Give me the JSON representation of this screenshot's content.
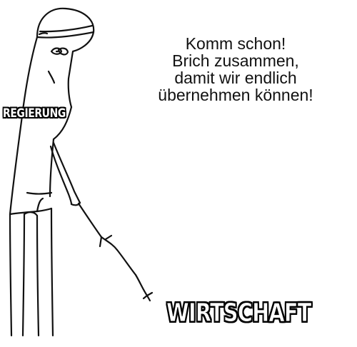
{
  "speech": {
    "lines": [
      "Komm schon!",
      "Brich zusammen,",
      "damit wir endlich",
      "übernehmen können!"
    ]
  },
  "labels": {
    "figure": "REGIERUNG",
    "ground": "WIRTSCHAFT"
  }
}
